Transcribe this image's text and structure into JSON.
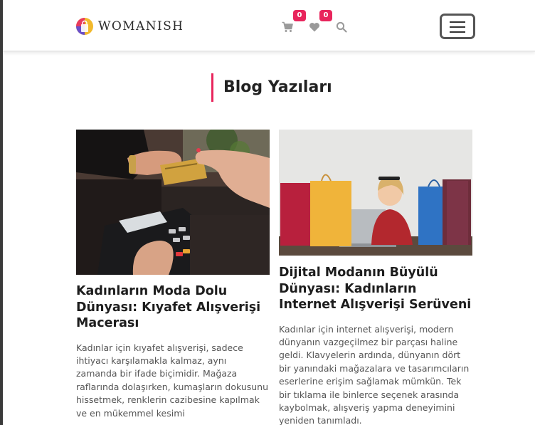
{
  "brand": {
    "name": "WOMANISH"
  },
  "nav": {
    "cart_count": "0",
    "wishlist_count": "0",
    "icons": [
      "cart-icon",
      "heart-icon",
      "search-icon",
      "menu-icon"
    ]
  },
  "page": {
    "title": "Blog Yazıları"
  },
  "posts": [
    {
      "title": "Kadınların Moda Dolu Dünyası: Kıyafet Alışverişi Macerası",
      "excerpt": "Kadınlar için kıyafet alışverişi, sadece ihtiyacı karşılamakla kalmaz, aynı zamanda bir ifade biçimidir. Mağaza raflarında dolaşırken, kumaşların dokusunu hissetmek, renklerin cazibesine kapılmak ve en mükemmel kesimi"
    },
    {
      "title": "Dijital Modanın Büyülü Dünyası: Kadınların Internet Alışverişi Serüveni",
      "excerpt": "Kadınlar için internet alışverişi, modern dünyanın vazgeçilmez bir parçası haline geldi. Klavyelerin ardında, dünyanın dört bir yanındaki mağazalara ve tasarımcıların eserlerine erişim sağlamak mümkün. Tek bir tıklama ile binlerce seçenek arasında kaybolmak, alışveriş yapma deneyimini yeniden tanımladı."
    }
  ],
  "colors": {
    "accent": "#e8255c",
    "title_bar": "#e8255c",
    "text": "#222222"
  }
}
